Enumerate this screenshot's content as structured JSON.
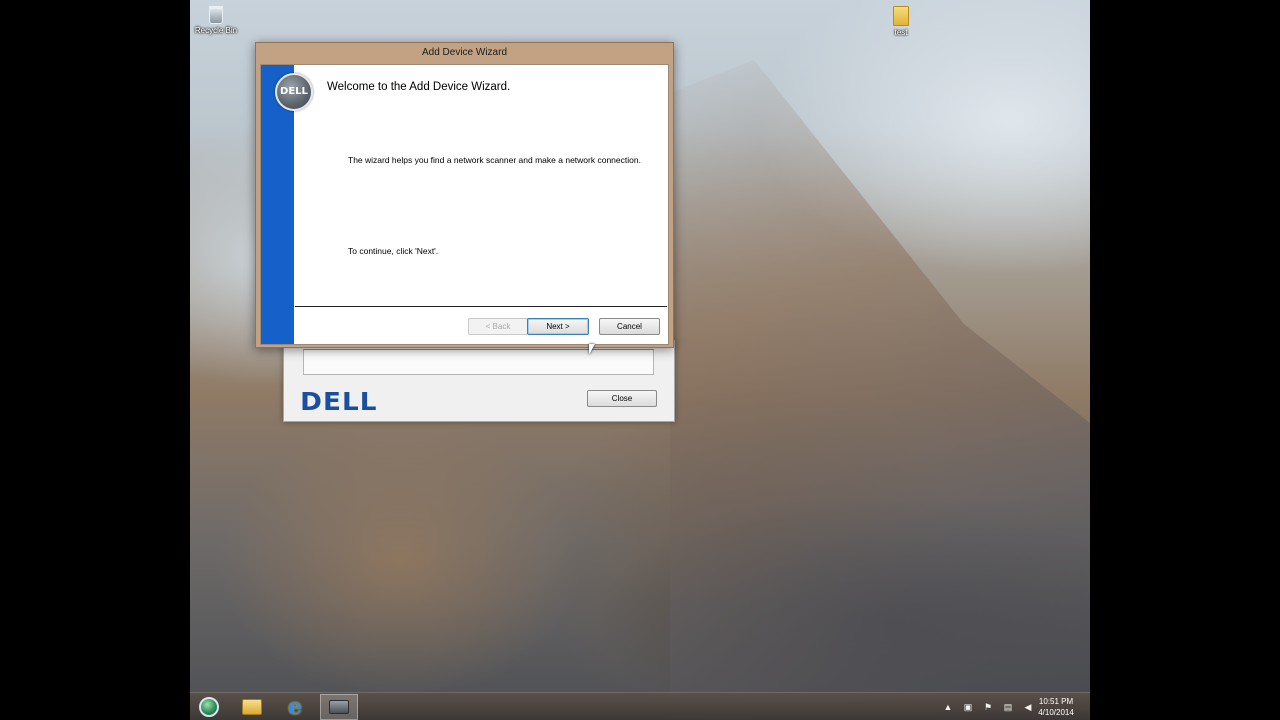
{
  "desktop": {
    "icons": [
      {
        "label": "Recycle Bin",
        "icon": "recycle-bin-icon"
      },
      {
        "label": "test",
        "icon": "folder-icon"
      }
    ]
  },
  "parent_window": {
    "logo_text": "DELL",
    "close_label": "Close"
  },
  "wizard": {
    "title": "Add Device Wizard",
    "badge_text": "DELL",
    "heading": "Welcome to the Add Device Wizard.",
    "description": "The wizard helps you find a network scanner and make a network connection.",
    "continue_text": "To continue, click 'Next'.",
    "buttons": {
      "back": "< Back",
      "next": "Next >",
      "cancel": "Cancel"
    },
    "colors": {
      "accent_bar": "#1561c9",
      "frame": "#c3a284"
    }
  },
  "taskbar": {
    "apps": [
      {
        "name": "start-orb",
        "icon": "globe-icon"
      },
      {
        "name": "file-explorer",
        "icon": "folder-icon"
      },
      {
        "name": "internet-explorer",
        "icon": "ie-icon"
      },
      {
        "name": "scanner-app",
        "icon": "scanner-icon",
        "active": true
      }
    ],
    "tray_icons": [
      "show-hidden-icon",
      "network-device-icon",
      "flag-icon",
      "network-icon",
      "volume-icon"
    ],
    "clock": {
      "time": "10:51 PM",
      "date": "4/10/2014"
    }
  }
}
